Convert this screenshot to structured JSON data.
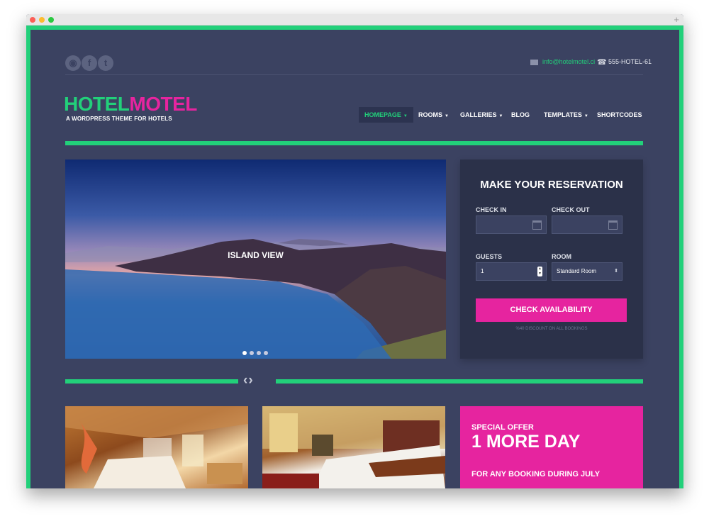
{
  "social": {
    "items": [
      {
        "name": "dribbble",
        "glyph": "◉"
      },
      {
        "name": "facebook",
        "glyph": "f"
      },
      {
        "name": "twitter",
        "glyph": "t"
      }
    ]
  },
  "contact": {
    "email": "info@hotelmotel.ci",
    "phone": "555-HOTEL-61"
  },
  "brand": {
    "name_part1": "HOTEL",
    "name_part2": "MOTEL",
    "tagline": "A WORDPRESS THEME FOR HOTELS"
  },
  "nav": {
    "items": [
      {
        "label": "HOMEPAGE",
        "caret": "▼"
      },
      {
        "label": "ROOMS",
        "caret": "▼"
      },
      {
        "label": "GALLERIES",
        "caret": "▼"
      },
      {
        "label": "BLOG",
        "caret": ""
      },
      {
        "label": "TEMPLATES",
        "caret": "▼"
      },
      {
        "label": "SHORTCODES",
        "caret": ""
      }
    ]
  },
  "hero": {
    "caption": "ISLAND VIEW",
    "slide_count": 4,
    "active_slide": 1
  },
  "reservation": {
    "title": "MAKE YOUR RESERVATION",
    "check_in_label": "CHECK IN",
    "check_out_label": "CHECK OUT",
    "guests_label": "GUESTS",
    "guests_value": "1",
    "room_label": "ROOM",
    "room_value": "Standard Room",
    "button": "CHECK AVAILABILITY",
    "note": "%40 DISCOUNT ON ALL BOOKINGS"
  },
  "divider": {
    "arrows": "‹›"
  },
  "offer": {
    "kicker": "SPECIAL OFFER",
    "title": "1 MORE DAY",
    "subtitle": "FOR ANY BOOKING DURING JULY"
  },
  "colors": {
    "accent_green": "#22d07a",
    "accent_pink": "#e6249f",
    "background": "#3b4261"
  }
}
